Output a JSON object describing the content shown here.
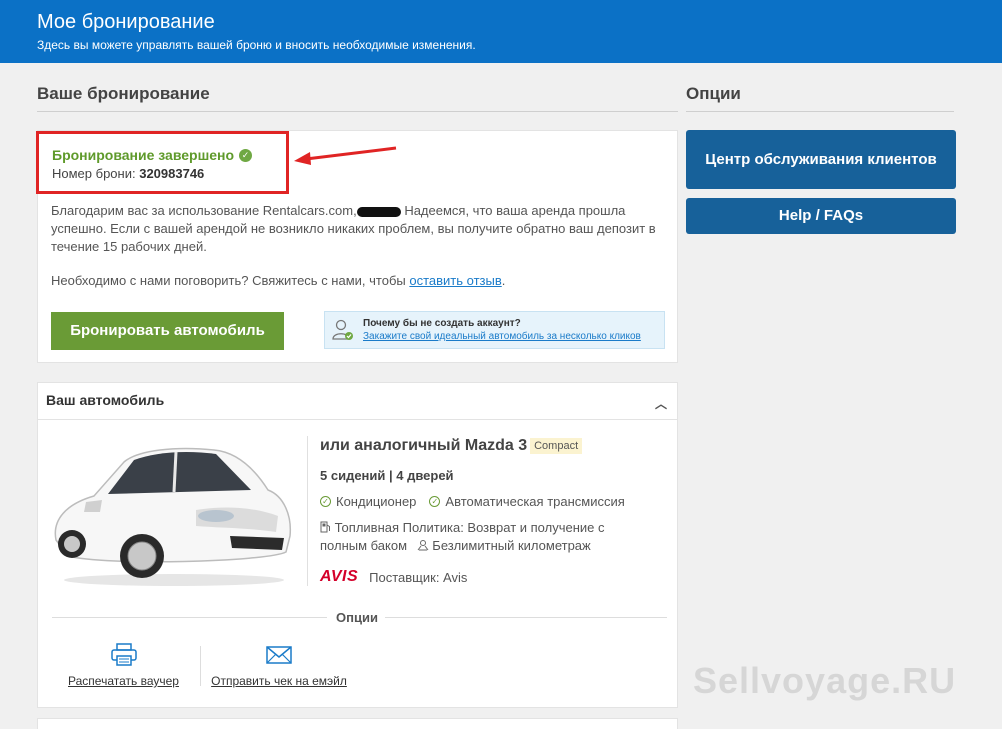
{
  "header": {
    "title": "Мое бронирование",
    "subtitle": "Здесь вы можете управлять вашей броню и вносить необходимые изменения."
  },
  "sections": {
    "booking_title": "Ваше бронирование",
    "options_title": "Опции"
  },
  "confirmation": {
    "status": "Бронирование завершено",
    "number_label": "Номер брони:",
    "number": "320983746"
  },
  "thanks": {
    "part1": "Благодарим вас за использование Rentalcars.com,",
    "part2": " Надеемся, что ваша аренда прошла успешно. Если с вашей арендой не возникло никаких проблем, вы получите обратно ваш депозит в течение 15 рабочих дней."
  },
  "contact": {
    "text": "Необходимо с нами поговорить? Свяжитесь с нами, чтобы ",
    "link": "оставить отзыв",
    "suffix": "."
  },
  "book_button": "Бронировать автомобиль",
  "account_prompt": {
    "question": "Почему бы не создать аккаунт?",
    "link": "Закажите свой идеальный автомобиль за несколько кликов"
  },
  "options": {
    "service_center": "Центр обслуживания клиентов",
    "help": "Help / FAQs"
  },
  "car": {
    "section_title": "Ваш автомобиль",
    "name": "или аналогичный Mazda 3",
    "class": "Compact",
    "seats_doors": "5 сидений | 4 дверей",
    "ac": "Кондиционер",
    "transmission": "Автоматическая трансмиссия",
    "fuel_policy": "Топливная Политика: Возврат и получение с полным баком",
    "mileage": "Безлимитный километраж",
    "supplier_logo": "AVIS",
    "supplier": "Поставщик: Avis",
    "options_label": "Опции",
    "print_voucher": "Распечатать ваучер",
    "email_receipt": "Отправить чек на емэйл"
  },
  "watermark": "Sellvoyage.RU",
  "colors": {
    "header_bg": "#0b71c6",
    "success_green": "#5f9a2b",
    "button_blue": "#17619a",
    "highlight_red": "#e02424"
  }
}
